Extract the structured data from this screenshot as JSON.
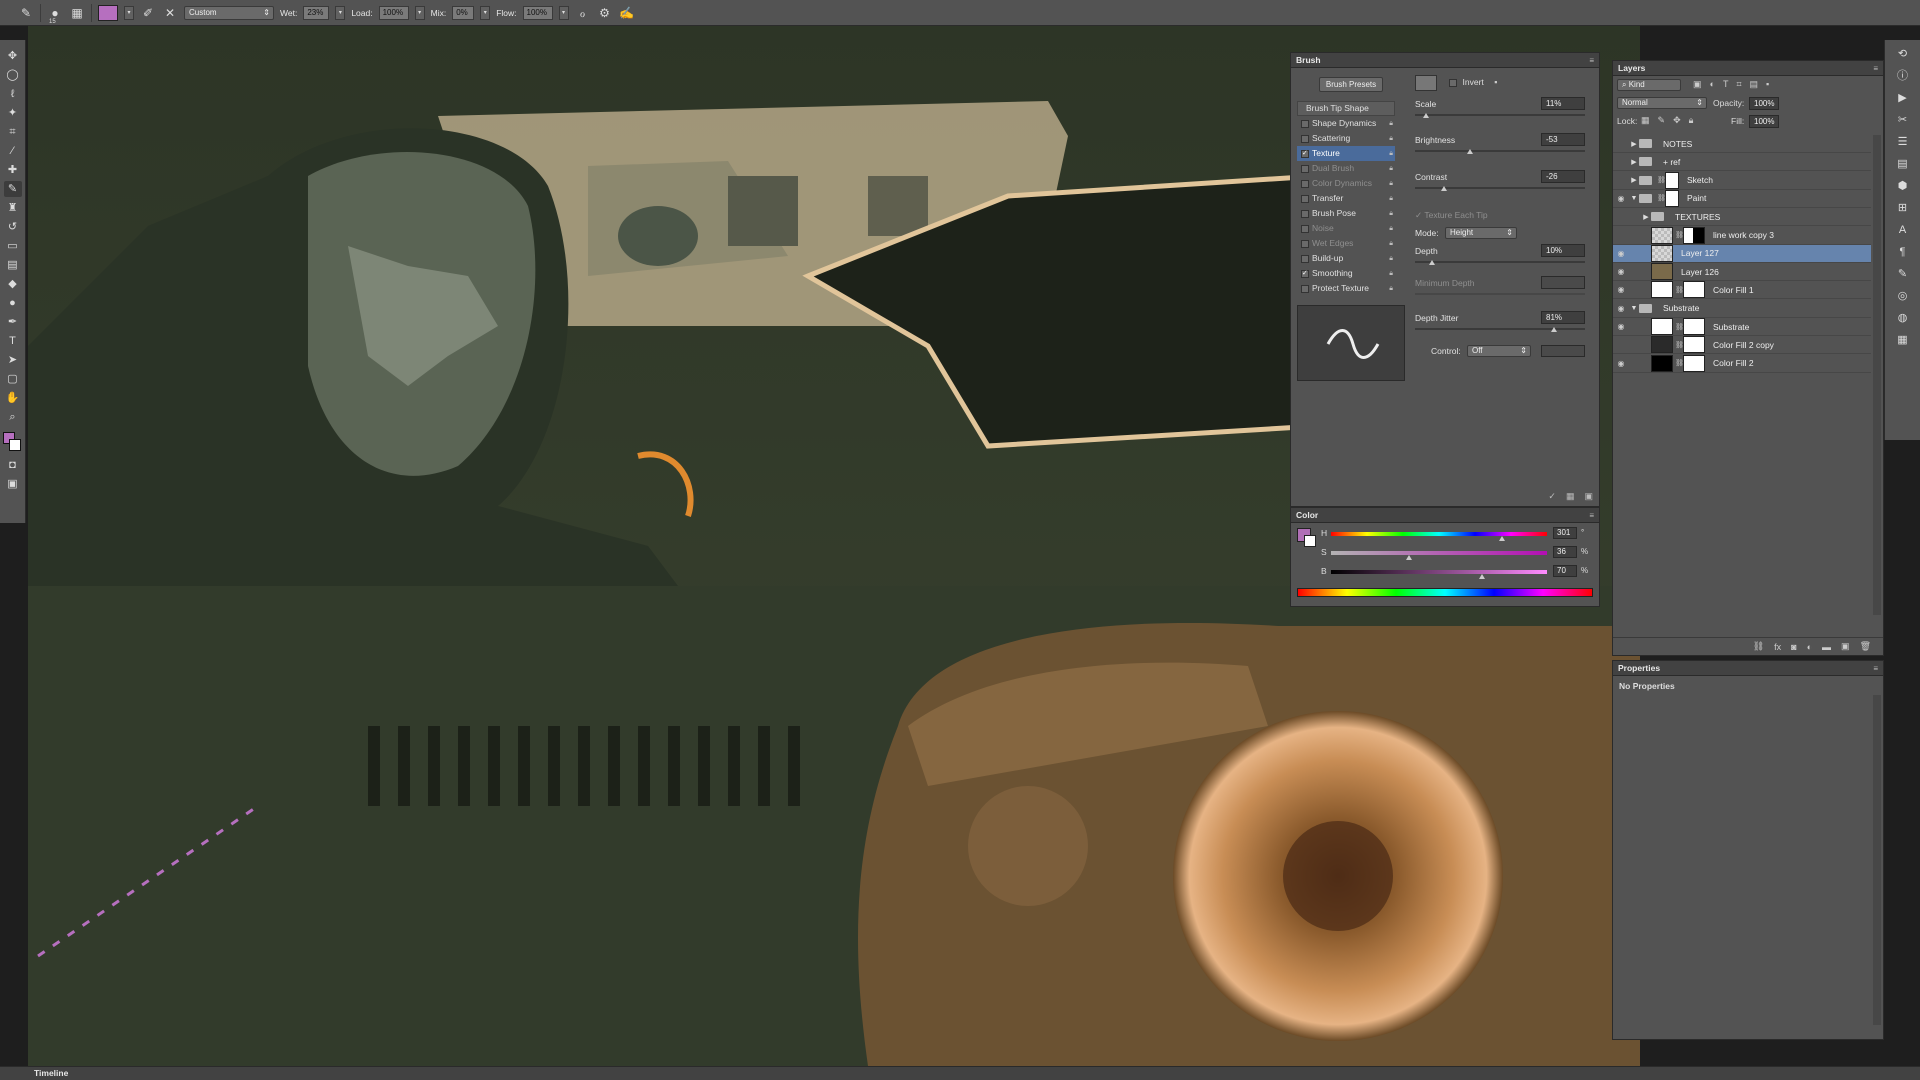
{
  "options_bar": {
    "brush_size": "15",
    "preset": "Custom",
    "wet_label": "Wet:",
    "wet_value": "23%",
    "load_label": "Load:",
    "load_value": "100%",
    "mix_label": "Mix:",
    "mix_value": "0%",
    "flow_label": "Flow:",
    "flow_value": "100%",
    "foreground_color": "#b66fbf"
  },
  "toolbar": {
    "tools": [
      "move-icon",
      "marquee-icon",
      "lasso-icon",
      "quick-select-icon",
      "crop-icon",
      "eyedropper-icon",
      "healing-icon",
      "mixer-brush-icon",
      "clone-stamp-icon",
      "history-brush-icon",
      "eraser-icon",
      "gradient-icon",
      "blur-icon",
      "dodge-icon",
      "pen-icon",
      "type-icon",
      "path-select-icon",
      "shape-icon",
      "hand-icon",
      "zoom-icon"
    ]
  },
  "brush_panel": {
    "title": "Brush",
    "presets_button": "Brush Presets",
    "invert_label": "Invert",
    "list": [
      {
        "label": "Brush Tip Shape",
        "checked": false,
        "state": "header"
      },
      {
        "label": "Shape Dynamics",
        "checked": false,
        "state": "normal"
      },
      {
        "label": "Scattering",
        "checked": false,
        "state": "normal"
      },
      {
        "label": "Texture",
        "checked": true,
        "state": "selected"
      },
      {
        "label": "Dual Brush",
        "checked": false,
        "state": "dim"
      },
      {
        "label": "Color Dynamics",
        "checked": false,
        "state": "dim"
      },
      {
        "label": "Transfer",
        "checked": false,
        "state": "normal"
      },
      {
        "label": "Brush Pose",
        "checked": false,
        "state": "normal"
      },
      {
        "label": "Noise",
        "checked": false,
        "state": "dim"
      },
      {
        "label": "Wet Edges",
        "checked": false,
        "state": "dim"
      },
      {
        "label": "Build-up",
        "checked": false,
        "state": "normal"
      },
      {
        "label": "Smoothing",
        "checked": true,
        "state": "normal"
      },
      {
        "label": "Protect Texture",
        "checked": false,
        "state": "normal"
      }
    ],
    "scale_label": "Scale",
    "scale_value": "11%",
    "brightness_label": "Brightness",
    "brightness_value": "-53",
    "contrast_label": "Contrast",
    "contrast_value": "-26",
    "texture_each_tip": "Texture Each Tip",
    "mode_label": "Mode:",
    "mode_value": "Height",
    "depth_label": "Depth",
    "depth_value": "10%",
    "min_depth_label": "Minimum Depth",
    "depth_jitter_label": "Depth Jitter",
    "depth_jitter_value": "81%",
    "control_label": "Control:",
    "control_value": "Off"
  },
  "color_panel": {
    "title": "Color",
    "h_label": "H",
    "h_value": "301",
    "h_unit": "°",
    "s_label": "S",
    "s_value": "36",
    "s_unit": "%",
    "b_label": "B",
    "b_value": "70",
    "b_unit": "%",
    "swatch": "#b06fb6"
  },
  "layers_panel": {
    "title": "Layers",
    "filter": "Kind",
    "blend_mode": "Normal",
    "opacity_label": "Opacity:",
    "opacity_value": "100%",
    "lock_label": "Lock:",
    "fill_label": "Fill:",
    "fill_value": "100%",
    "layers": [
      {
        "name": "NOTES",
        "type": "folder",
        "visible": false,
        "indent": 0,
        "selected": false
      },
      {
        "name": "+ ref",
        "type": "folder",
        "visible": false,
        "indent": 0,
        "selected": false
      },
      {
        "name": "Sketch",
        "type": "folder-mask",
        "visible": false,
        "indent": 0,
        "selected": false
      },
      {
        "name": "Paint",
        "type": "folder-mask-open",
        "visible": true,
        "indent": 0,
        "selected": false
      },
      {
        "name": "TEXTURES",
        "type": "folder",
        "visible": false,
        "indent": 1,
        "selected": false
      },
      {
        "name": "line work copy 3",
        "type": "layer-mask",
        "visible": false,
        "indent": 1,
        "selected": false
      },
      {
        "name": "Layer 127",
        "type": "layer",
        "visible": true,
        "indent": 1,
        "selected": true
      },
      {
        "name": "Layer 126",
        "type": "layer-img",
        "visible": true,
        "indent": 1,
        "selected": false
      },
      {
        "name": "Color Fill 1",
        "type": "fill",
        "visible": true,
        "indent": 1,
        "selected": false
      },
      {
        "name": "Substrate",
        "type": "folder-open",
        "visible": true,
        "indent": 0,
        "selected": false
      },
      {
        "name": "Substrate",
        "type": "fill",
        "visible": true,
        "indent": 1,
        "selected": false
      },
      {
        "name": "Color Fill 2 copy",
        "type": "fill-dark",
        "visible": false,
        "indent": 1,
        "selected": false
      },
      {
        "name": "Color Fill 2",
        "type": "fill-black",
        "visible": true,
        "indent": 1,
        "selected": false
      }
    ]
  },
  "properties_panel": {
    "title": "Properties",
    "message": "No Properties"
  },
  "timeline": {
    "title": "Timeline"
  }
}
